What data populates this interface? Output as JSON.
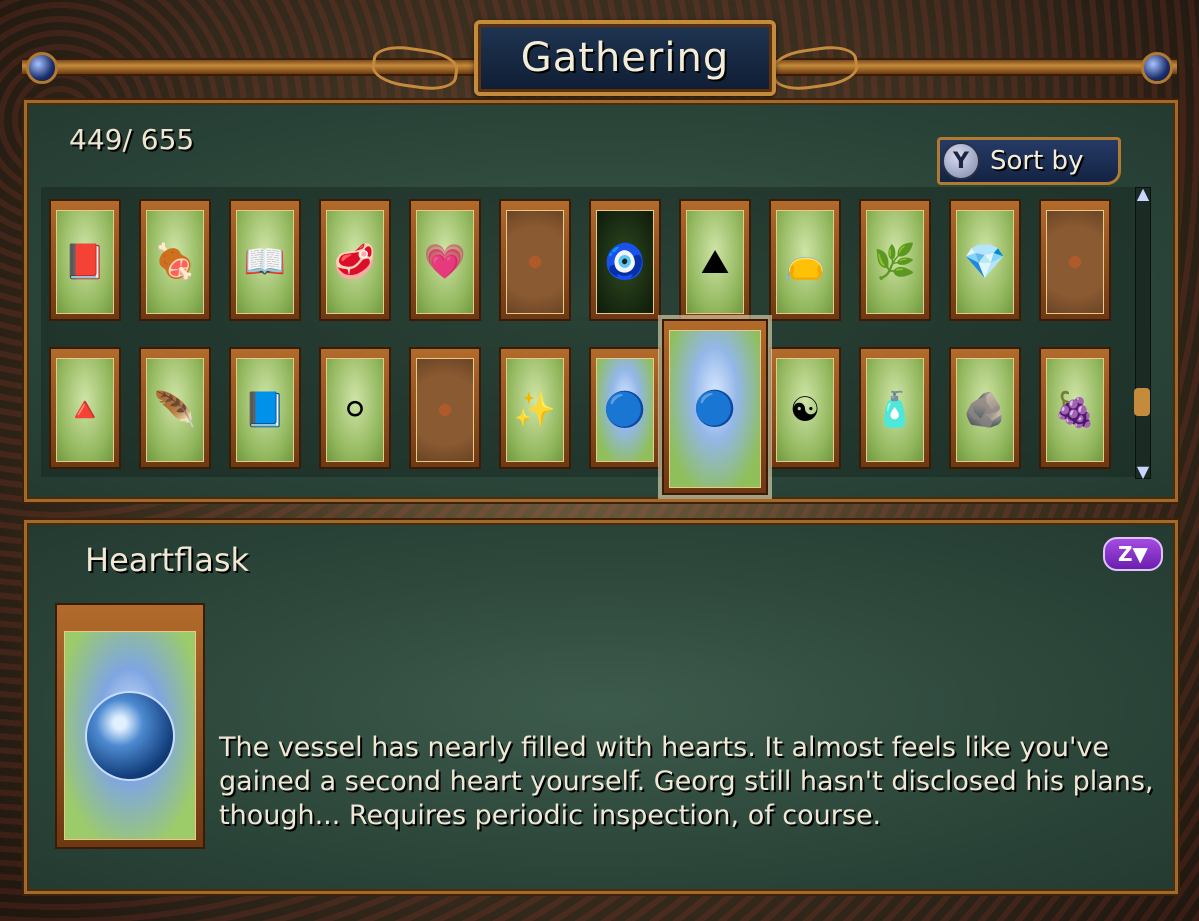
{
  "header": {
    "title": "Gathering"
  },
  "inventory": {
    "count": "449/  655"
  },
  "sort": {
    "button_badge": "Y",
    "label": "Sort by"
  },
  "items_row1": [
    {
      "icon": "book-icon",
      "glyph": "📕",
      "style": ""
    },
    {
      "icon": "steak-plate-icon",
      "glyph": "🍖",
      "style": ""
    },
    {
      "icon": "open-book-icon",
      "glyph": "📖",
      "style": ""
    },
    {
      "icon": "raw-meat-icon",
      "glyph": "🥩",
      "style": ""
    },
    {
      "icon": "heart-crystal-icon",
      "glyph": "💗",
      "style": ""
    },
    {
      "icon": "card-back-icon",
      "glyph": "",
      "style": "back"
    },
    {
      "icon": "blue-creature-icon",
      "glyph": "🧿",
      "style": "dark"
    },
    {
      "icon": "ash-pile-icon",
      "glyph": "⛰",
      "style": ""
    },
    {
      "icon": "black-pouch-icon",
      "glyph": "👝",
      "style": ""
    },
    {
      "icon": "branch-icon",
      "glyph": "🌿",
      "style": ""
    },
    {
      "icon": "diamond-icon",
      "glyph": "💎",
      "style": ""
    },
    {
      "icon": "card-back-icon",
      "glyph": "",
      "style": "back"
    }
  ],
  "items_row2": [
    {
      "icon": "dark-spire-icon",
      "glyph": "🔺",
      "style": ""
    },
    {
      "icon": "quill-book-icon",
      "glyph": "🪶",
      "style": ""
    },
    {
      "icon": "tome-icon",
      "glyph": "📘",
      "style": ""
    },
    {
      "icon": "pearl-icon",
      "glyph": "⚪",
      "style": ""
    },
    {
      "icon": "card-back-icon",
      "glyph": "",
      "style": "back"
    },
    {
      "icon": "sparkle-orb-icon",
      "glyph": "✨",
      "style": ""
    },
    {
      "icon": "small-heartflask-icon",
      "glyph": "🔵",
      "style": "star"
    },
    {
      "icon": "heartflask-icon",
      "glyph": "🔵",
      "style": "star"
    },
    {
      "icon": "yin-yang-icon",
      "glyph": "☯",
      "style": ""
    },
    {
      "icon": "potion-bottle-icon",
      "glyph": "🧴",
      "style": ""
    },
    {
      "icon": "white-stone-icon",
      "glyph": "🪨",
      "style": ""
    },
    {
      "icon": "purple-gems-icon",
      "glyph": "🍇",
      "style": ""
    }
  ],
  "selected": {
    "name": "Heartflask",
    "badge": "Z▼",
    "description": "The vessel has nearly filled with hearts. It almost feels like you've gained a second heart yourself. Georg still hasn't disclosed his plans, though... Requires periodic inspection, of course."
  }
}
